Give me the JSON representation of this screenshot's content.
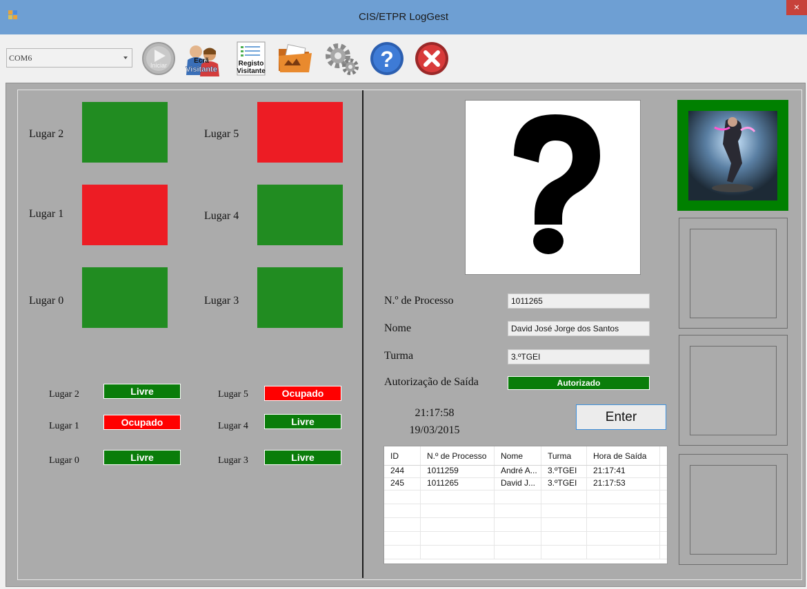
{
  "window": {
    "title": "CIS/ETPR LogGest",
    "close": "×"
  },
  "toolbar": {
    "port": "COM6",
    "start_label": "Iniciar",
    "visitor_screen_label_1": "Ecrã",
    "visitor_screen_label_2": "Visitante",
    "visitor_register_label_1": "Registo",
    "visitor_register_label_2": "Visitante"
  },
  "spots": [
    {
      "label": "Lugar 2",
      "state": "free"
    },
    {
      "label": "Lugar 5",
      "state": "occupied"
    },
    {
      "label": "Lugar 1",
      "state": "occupied"
    },
    {
      "label": "Lugar 4",
      "state": "free"
    },
    {
      "label": "Lugar 0",
      "state": "free"
    },
    {
      "label": "Lugar 3",
      "state": "free"
    }
  ],
  "status_list": [
    {
      "label": "Lugar 2",
      "status": "Livre"
    },
    {
      "label": "Lugar 5",
      "status": "Ocupado"
    },
    {
      "label": "Lugar 1",
      "status": "Ocupado"
    },
    {
      "label": "Lugar 4",
      "status": "Livre"
    },
    {
      "label": "Lugar 0",
      "status": "Livre"
    },
    {
      "label": "Lugar 3",
      "status": "Livre"
    }
  ],
  "colors": {
    "free": "#218c21",
    "occupied": "#ed1c24",
    "free_badge": "#0a7d0a",
    "occupied_badge": "#ff0000",
    "active_frame": "#008000"
  },
  "details": {
    "process_label": "N.º de Processo",
    "process_value": "1011265",
    "name_label": "Nome",
    "name_value": "David José Jorge dos Santos",
    "class_label": "Turma",
    "class_value": "3.ºTGEI",
    "auth_label": "Autorização de Saída",
    "auth_value": "Autorizado"
  },
  "clock": {
    "time": "21:17:58",
    "date": "19/03/2015"
  },
  "enter_label": "Enter",
  "log_table": {
    "columns": [
      "ID",
      "N.º de Processo",
      "Nome",
      "Turma",
      "Hora de Saída"
    ],
    "rows": [
      [
        "244",
        "1011259",
        "André A...",
        "3.ºTGEI",
        "21:17:41"
      ],
      [
        "245",
        "1011265",
        "David J...",
        "3.ºTGEI",
        "21:17:53"
      ]
    ]
  }
}
